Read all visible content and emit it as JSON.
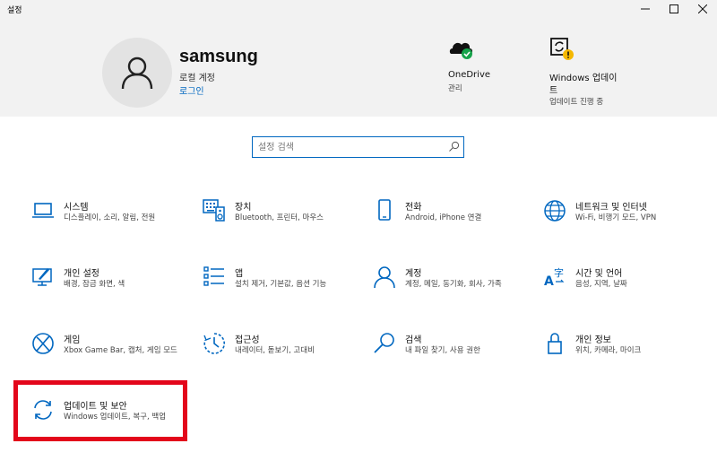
{
  "window": {
    "title": "설정"
  },
  "header": {
    "username": "samsung",
    "account_type": "로컬 계정",
    "login_link": "로그인",
    "onedrive": {
      "title": "OneDrive",
      "sub": "관리"
    },
    "windows_update": {
      "title_line1": "Windows 업데이",
      "title_line2": "트",
      "sub": "업데이트 진행 중"
    }
  },
  "search": {
    "placeholder": "설정 검색"
  },
  "tiles": [
    {
      "title": "시스템",
      "desc": "디스플레이, 소리, 알림, 전원",
      "icon": "laptop-icon"
    },
    {
      "title": "장치",
      "desc": "Bluetooth, 프린터, 마우스",
      "icon": "keyboard-speaker-icon"
    },
    {
      "title": "전화",
      "desc": "Android, iPhone 연결",
      "icon": "phone-icon"
    },
    {
      "title": "네트워크 및 인터넷",
      "desc": "Wi-Fi, 비행기 모드, VPN",
      "icon": "globe-icon"
    },
    {
      "title": "개인 설정",
      "desc": "배경, 잠금 화면, 색",
      "icon": "paint-monitor-icon"
    },
    {
      "title": "앱",
      "desc": "설치 제거, 기본값, 옵션 기능",
      "icon": "apps-list-icon"
    },
    {
      "title": "계정",
      "desc": "계정, 메일, 동기화, 회사, 가족",
      "icon": "person-icon"
    },
    {
      "title": "시간 및 언어",
      "desc": "음성, 지역, 날짜",
      "icon": "language-icon"
    },
    {
      "title": "게임",
      "desc": "Xbox Game Bar, 캡처, 게임 모드",
      "icon": "xbox-icon"
    },
    {
      "title": "접근성",
      "desc": "내레이터, 돋보기, 고대비",
      "icon": "ease-of-access-icon"
    },
    {
      "title": "검색",
      "desc": "내 파일 찾기, 사용 권한",
      "icon": "magnifier-icon"
    },
    {
      "title": "개인 정보",
      "desc": "위치, 카메라, 마이크",
      "icon": "lock-icon"
    },
    {
      "title": "업데이트 및 보안",
      "desc": "Windows 업데이트, 복구, 백업",
      "icon": "sync-icon"
    }
  ],
  "colors": {
    "accent": "#0067c0",
    "highlight": "#e3061b",
    "header_bg": "#f2f2f2"
  }
}
